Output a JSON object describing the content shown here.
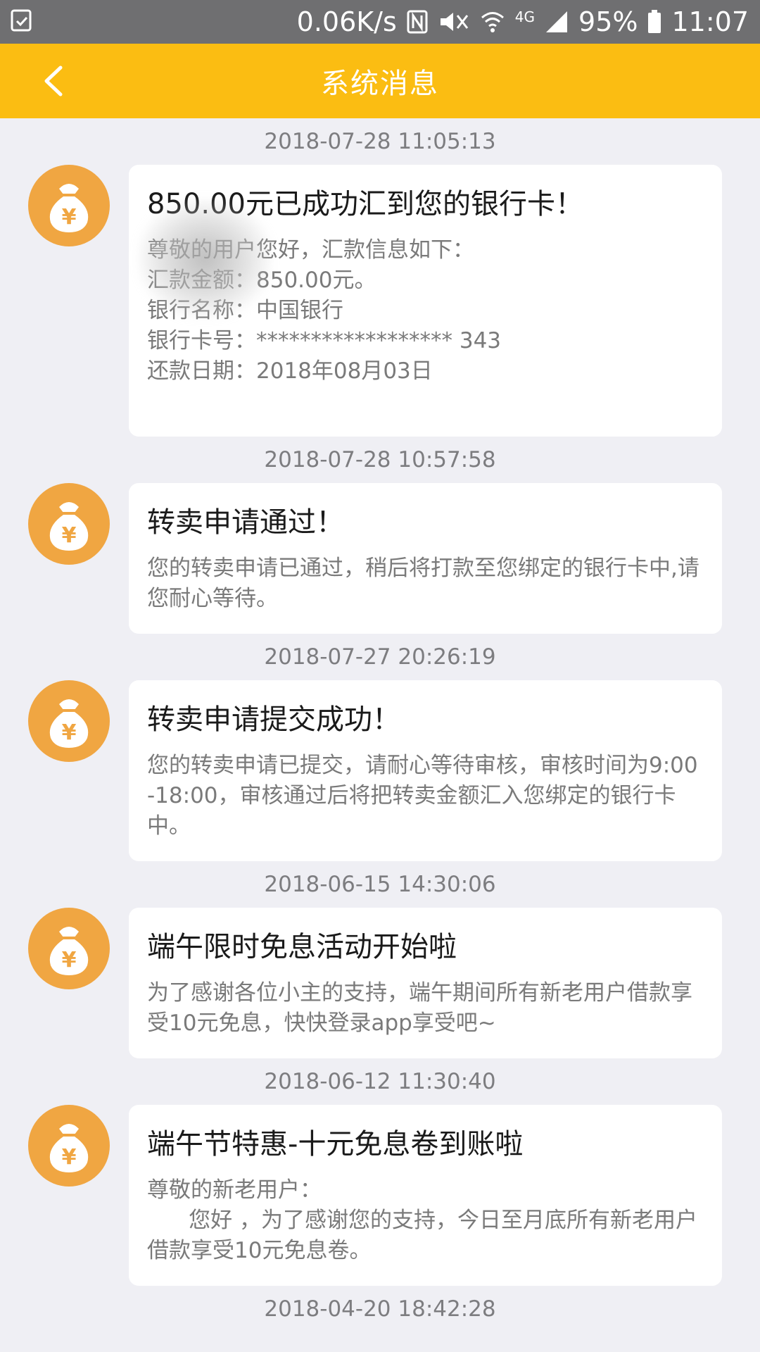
{
  "status_bar": {
    "speed": "0.06K/s",
    "network": "4G",
    "battery": "95%",
    "time": "11:07"
  },
  "header": {
    "title": "系统消息"
  },
  "messages": [
    {
      "timestamp": "2018-07-28 11:05:13",
      "title": "850.00元已成功汇到您的银行卡！",
      "body": "尊敬的用户您好，汇款信息如下：\n汇款金额：850.00元。\n银行名称：中国银行\n银行卡号：****************** 343\n还款日期：2018年08月03日\n"
    },
    {
      "timestamp": "2018-07-28 10:57:58",
      "title": "转卖申请通过！",
      "body": "您的转卖申请已通过，稍后将打款至您绑定的银行卡中,请您耐心等待。"
    },
    {
      "timestamp": "2018-07-27 20:26:19",
      "title": "转卖申请提交成功！",
      "body": "您的转卖申请已提交，请耐心等待审核，审核时间为9:00-18:00，审核通过后将把转卖金额汇入您绑定的银行卡中。"
    },
    {
      "timestamp": "2018-06-15 14:30:06",
      "title": "端午限时免息活动开始啦",
      "body": "为了感谢各位小主的支持，端午期间所有新老用户借款享受10元免息，快快登录app享受吧~"
    },
    {
      "timestamp": "2018-06-12 11:30:40",
      "title": "端午节特惠-十元免息卷到账啦",
      "body": "尊敬的新老用户：\n      您好 ，为了感谢您的支持，今日至月底所有新老用户借款享受10元免息卷。"
    }
  ],
  "next_timestamp": "2018-04-20 18:42:28"
}
